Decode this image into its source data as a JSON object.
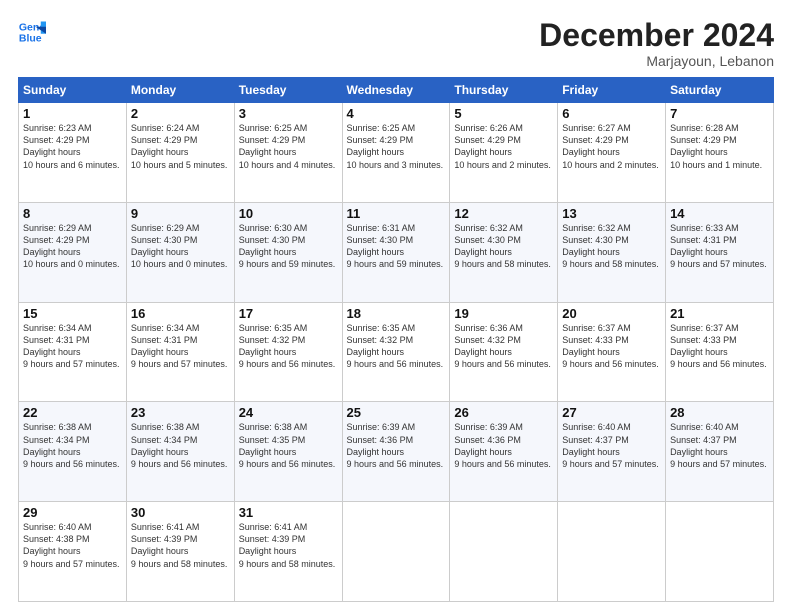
{
  "header": {
    "logo_line1": "General",
    "logo_line2": "Blue",
    "month": "December 2024",
    "location": "Marjayoun, Lebanon"
  },
  "days_of_week": [
    "Sunday",
    "Monday",
    "Tuesday",
    "Wednesday",
    "Thursday",
    "Friday",
    "Saturday"
  ],
  "weeks": [
    [
      {
        "day": 1,
        "sunrise": "6:23 AM",
        "sunset": "4:29 PM",
        "daylight": "10 hours and 6 minutes."
      },
      {
        "day": 2,
        "sunrise": "6:24 AM",
        "sunset": "4:29 PM",
        "daylight": "10 hours and 5 minutes."
      },
      {
        "day": 3,
        "sunrise": "6:25 AM",
        "sunset": "4:29 PM",
        "daylight": "10 hours and 4 minutes."
      },
      {
        "day": 4,
        "sunrise": "6:25 AM",
        "sunset": "4:29 PM",
        "daylight": "10 hours and 3 minutes."
      },
      {
        "day": 5,
        "sunrise": "6:26 AM",
        "sunset": "4:29 PM",
        "daylight": "10 hours and 2 minutes."
      },
      {
        "day": 6,
        "sunrise": "6:27 AM",
        "sunset": "4:29 PM",
        "daylight": "10 hours and 2 minutes."
      },
      {
        "day": 7,
        "sunrise": "6:28 AM",
        "sunset": "4:29 PM",
        "daylight": "10 hours and 1 minute."
      }
    ],
    [
      {
        "day": 8,
        "sunrise": "6:29 AM",
        "sunset": "4:29 PM",
        "daylight": "10 hours and 0 minutes."
      },
      {
        "day": 9,
        "sunrise": "6:29 AM",
        "sunset": "4:30 PM",
        "daylight": "10 hours and 0 minutes."
      },
      {
        "day": 10,
        "sunrise": "6:30 AM",
        "sunset": "4:30 PM",
        "daylight": "9 hours and 59 minutes."
      },
      {
        "day": 11,
        "sunrise": "6:31 AM",
        "sunset": "4:30 PM",
        "daylight": "9 hours and 59 minutes."
      },
      {
        "day": 12,
        "sunrise": "6:32 AM",
        "sunset": "4:30 PM",
        "daylight": "9 hours and 58 minutes."
      },
      {
        "day": 13,
        "sunrise": "6:32 AM",
        "sunset": "4:30 PM",
        "daylight": "9 hours and 58 minutes."
      },
      {
        "day": 14,
        "sunrise": "6:33 AM",
        "sunset": "4:31 PM",
        "daylight": "9 hours and 57 minutes."
      }
    ],
    [
      {
        "day": 15,
        "sunrise": "6:34 AM",
        "sunset": "4:31 PM",
        "daylight": "9 hours and 57 minutes."
      },
      {
        "day": 16,
        "sunrise": "6:34 AM",
        "sunset": "4:31 PM",
        "daylight": "9 hours and 57 minutes."
      },
      {
        "day": 17,
        "sunrise": "6:35 AM",
        "sunset": "4:32 PM",
        "daylight": "9 hours and 56 minutes."
      },
      {
        "day": 18,
        "sunrise": "6:35 AM",
        "sunset": "4:32 PM",
        "daylight": "9 hours and 56 minutes."
      },
      {
        "day": 19,
        "sunrise": "6:36 AM",
        "sunset": "4:32 PM",
        "daylight": "9 hours and 56 minutes."
      },
      {
        "day": 20,
        "sunrise": "6:37 AM",
        "sunset": "4:33 PM",
        "daylight": "9 hours and 56 minutes."
      },
      {
        "day": 21,
        "sunrise": "6:37 AM",
        "sunset": "4:33 PM",
        "daylight": "9 hours and 56 minutes."
      }
    ],
    [
      {
        "day": 22,
        "sunrise": "6:38 AM",
        "sunset": "4:34 PM",
        "daylight": "9 hours and 56 minutes."
      },
      {
        "day": 23,
        "sunrise": "6:38 AM",
        "sunset": "4:34 PM",
        "daylight": "9 hours and 56 minutes."
      },
      {
        "day": 24,
        "sunrise": "6:38 AM",
        "sunset": "4:35 PM",
        "daylight": "9 hours and 56 minutes."
      },
      {
        "day": 25,
        "sunrise": "6:39 AM",
        "sunset": "4:36 PM",
        "daylight": "9 hours and 56 minutes."
      },
      {
        "day": 26,
        "sunrise": "6:39 AM",
        "sunset": "4:36 PM",
        "daylight": "9 hours and 56 minutes."
      },
      {
        "day": 27,
        "sunrise": "6:40 AM",
        "sunset": "4:37 PM",
        "daylight": "9 hours and 57 minutes."
      },
      {
        "day": 28,
        "sunrise": "6:40 AM",
        "sunset": "4:37 PM",
        "daylight": "9 hours and 57 minutes."
      }
    ],
    [
      {
        "day": 29,
        "sunrise": "6:40 AM",
        "sunset": "4:38 PM",
        "daylight": "9 hours and 57 minutes."
      },
      {
        "day": 30,
        "sunrise": "6:41 AM",
        "sunset": "4:39 PM",
        "daylight": "9 hours and 58 minutes."
      },
      {
        "day": 31,
        "sunrise": "6:41 AM",
        "sunset": "4:39 PM",
        "daylight": "9 hours and 58 minutes."
      },
      null,
      null,
      null,
      null
    ]
  ]
}
